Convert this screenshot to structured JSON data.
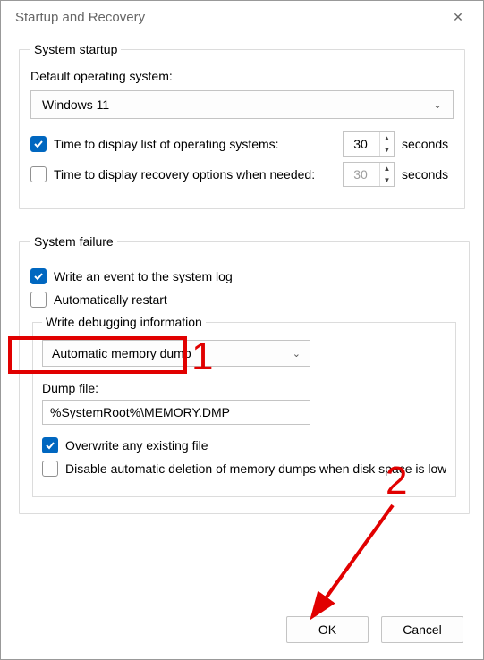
{
  "title": "Startup and Recovery",
  "close_icon": "✕",
  "groups": {
    "startup": {
      "legend": "System startup",
      "os_label": "Default operating system:",
      "os_value": "Windows 11",
      "display_os": {
        "label": "Time to display list of operating systems:",
        "checked": true,
        "value": "30",
        "suffix": "seconds"
      },
      "display_recovery": {
        "label": "Time to display recovery options when needed:",
        "checked": false,
        "value": "30",
        "suffix": "seconds"
      }
    },
    "failure": {
      "legend": "System failure",
      "write_event": {
        "label": "Write an event to the system log",
        "checked": true
      },
      "auto_restart": {
        "label": "Automatically restart",
        "checked": false
      },
      "debug": {
        "legend": "Write debugging information",
        "type_value": "Automatic memory dump",
        "dump_label": "Dump file:",
        "dump_value": "%SystemRoot%\\MEMORY.DMP",
        "overwrite": {
          "label": "Overwrite any existing file",
          "checked": true
        },
        "disable_auto_delete": {
          "label": "Disable automatic deletion of memory dumps when disk space is low",
          "checked": false
        }
      }
    }
  },
  "buttons": {
    "ok": "OK",
    "cancel": "Cancel"
  },
  "annotations": {
    "one": "1",
    "two": "2"
  }
}
